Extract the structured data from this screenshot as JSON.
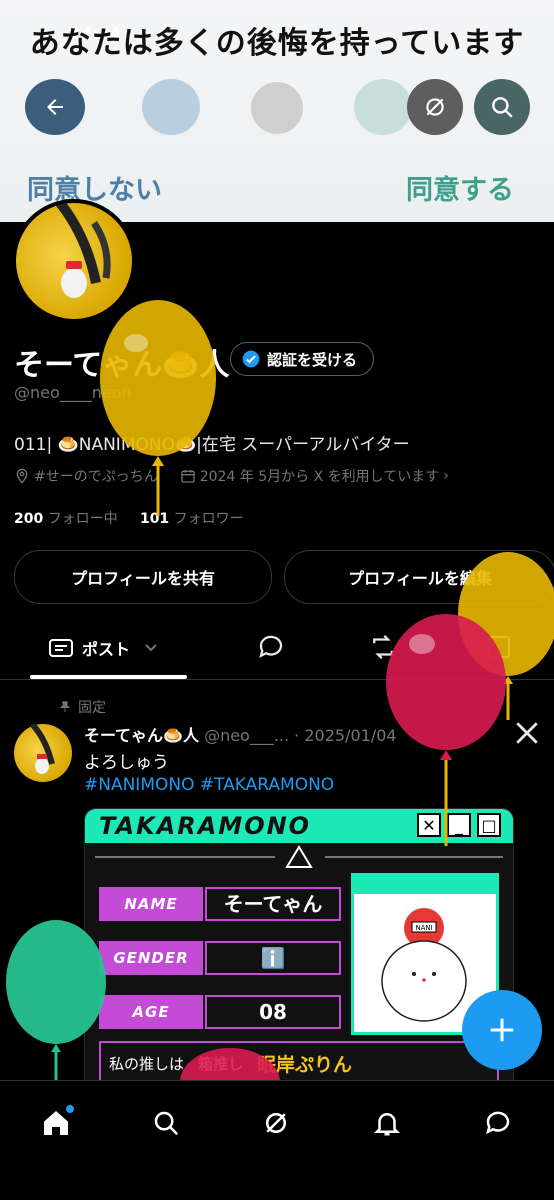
{
  "overlay": {
    "banner_text": "あなたは多くの後悔を持っています",
    "time": "14:44",
    "disagree_label": "同意しない",
    "agree_label": "同意する"
  },
  "profile": {
    "display_name": "そーてゃん🍮人",
    "handle": "@neo____neon",
    "verify_label": "認証を受ける",
    "bio": "011| 🍮NANIMONO🍮|在宅 スーパーアルバイター",
    "location": "#せーのでぷっちん",
    "joined": "2024 年 5月から X を利用しています",
    "following_count": "200",
    "following_label": "フォロー中",
    "followers_count": "101",
    "followers_label": "フォロワー",
    "share_label": "プロフィールを共有",
    "edit_label": "プロフィールを編集"
  },
  "tabs": {
    "posts_label": "ポスト"
  },
  "post": {
    "pinned_label": "固定",
    "name": "そーてゃん🍮人",
    "meta": "@neo___... · 2025/01/04",
    "text": "よろしゅう",
    "tags": "#NANIMONO #TAKARAMONO"
  },
  "card": {
    "title": "TAKARAMONO",
    "name_label": "NAME",
    "name_value": "そーてゃん",
    "gender_label": "GENDER",
    "gender_value": "ℹ️",
    "age_label": "AGE",
    "age_value": "08",
    "oshi_label": "私の推しは",
    "oshi_type": "箱推し",
    "oshi_value": "眠岸ぷりん",
    "pic_badge": "NANI"
  },
  "colors": {
    "accent": "#1d9bf0",
    "card_teal": "#1de9b6",
    "card_purple": "#c34bd6"
  }
}
